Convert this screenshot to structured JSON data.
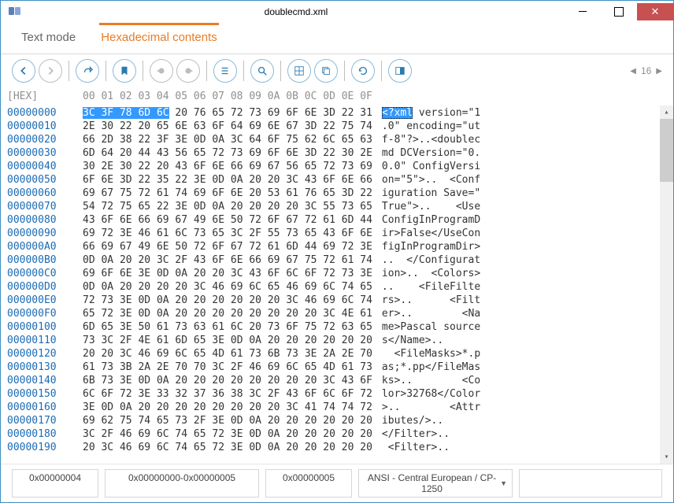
{
  "window": {
    "title": "doublecmd.xml"
  },
  "tabs": {
    "text": "Text mode",
    "hex": "Hexadecimal contents"
  },
  "page": {
    "num": "16"
  },
  "header": {
    "label": "[HEX]",
    "cols": "00 01 02 03 04 05 06 07 08 09 0A 0B 0C 0D 0E 0F"
  },
  "rows": [
    {
      "o": "00000000",
      "b": [
        "3C",
        "3F",
        "78",
        "6D",
        "6C",
        "20",
        "76",
        "65",
        "72",
        "73",
        "69",
        "6F",
        "6E",
        "3D",
        "22",
        "31"
      ],
      "a": "<?xml version=\"1",
      "sel": 5
    },
    {
      "o": "00000010",
      "b": [
        "2E",
        "30",
        "22",
        "20",
        "65",
        "6E",
        "63",
        "6F",
        "64",
        "69",
        "6E",
        "67",
        "3D",
        "22",
        "75",
        "74"
      ],
      "a": ".0\" encoding=\"ut"
    },
    {
      "o": "00000020",
      "b": [
        "66",
        "2D",
        "38",
        "22",
        "3F",
        "3E",
        "0D",
        "0A",
        "3C",
        "64",
        "6F",
        "75",
        "62",
        "6C",
        "65",
        "63"
      ],
      "a": "f-8\"?>..<doublec"
    },
    {
      "o": "00000030",
      "b": [
        "6D",
        "64",
        "20",
        "44",
        "43",
        "56",
        "65",
        "72",
        "73",
        "69",
        "6F",
        "6E",
        "3D",
        "22",
        "30",
        "2E"
      ],
      "a": "md DCVersion=\"0."
    },
    {
      "o": "00000040",
      "b": [
        "30",
        "2E",
        "30",
        "22",
        "20",
        "43",
        "6F",
        "6E",
        "66",
        "69",
        "67",
        "56",
        "65",
        "72",
        "73",
        "69"
      ],
      "a": "0.0\" ConfigVersi"
    },
    {
      "o": "00000050",
      "b": [
        "6F",
        "6E",
        "3D",
        "22",
        "35",
        "22",
        "3E",
        "0D",
        "0A",
        "20",
        "20",
        "3C",
        "43",
        "6F",
        "6E",
        "66"
      ],
      "a": "on=\"5\">..  <Conf"
    },
    {
      "o": "00000060",
      "b": [
        "69",
        "67",
        "75",
        "72",
        "61",
        "74",
        "69",
        "6F",
        "6E",
        "20",
        "53",
        "61",
        "76",
        "65",
        "3D",
        "22"
      ],
      "a": "iguration Save=\""
    },
    {
      "o": "00000070",
      "b": [
        "54",
        "72",
        "75",
        "65",
        "22",
        "3E",
        "0D",
        "0A",
        "20",
        "20",
        "20",
        "20",
        "3C",
        "55",
        "73",
        "65"
      ],
      "a": "True\">..    <Use"
    },
    {
      "o": "00000080",
      "b": [
        "43",
        "6F",
        "6E",
        "66",
        "69",
        "67",
        "49",
        "6E",
        "50",
        "72",
        "6F",
        "67",
        "72",
        "61",
        "6D",
        "44"
      ],
      "a": "ConfigInProgramD"
    },
    {
      "o": "00000090",
      "b": [
        "69",
        "72",
        "3E",
        "46",
        "61",
        "6C",
        "73",
        "65",
        "3C",
        "2F",
        "55",
        "73",
        "65",
        "43",
        "6F",
        "6E"
      ],
      "a": "ir>False</UseCon"
    },
    {
      "o": "000000A0",
      "b": [
        "66",
        "69",
        "67",
        "49",
        "6E",
        "50",
        "72",
        "6F",
        "67",
        "72",
        "61",
        "6D",
        "44",
        "69",
        "72",
        "3E"
      ],
      "a": "figInProgramDir>"
    },
    {
      "o": "000000B0",
      "b": [
        "0D",
        "0A",
        "20",
        "20",
        "3C",
        "2F",
        "43",
        "6F",
        "6E",
        "66",
        "69",
        "67",
        "75",
        "72",
        "61",
        "74"
      ],
      "a": "..  </Configurat"
    },
    {
      "o": "000000C0",
      "b": [
        "69",
        "6F",
        "6E",
        "3E",
        "0D",
        "0A",
        "20",
        "20",
        "3C",
        "43",
        "6F",
        "6C",
        "6F",
        "72",
        "73",
        "3E"
      ],
      "a": "ion>..  <Colors>"
    },
    {
      "o": "000000D0",
      "b": [
        "0D",
        "0A",
        "20",
        "20",
        "20",
        "20",
        "3C",
        "46",
        "69",
        "6C",
        "65",
        "46",
        "69",
        "6C",
        "74",
        "65"
      ],
      "a": "..    <FileFilte"
    },
    {
      "o": "000000E0",
      "b": [
        "72",
        "73",
        "3E",
        "0D",
        "0A",
        "20",
        "20",
        "20",
        "20",
        "20",
        "20",
        "3C",
        "46",
        "69",
        "6C",
        "74"
      ],
      "a": "rs>..      <Filt"
    },
    {
      "o": "000000F0",
      "b": [
        "65",
        "72",
        "3E",
        "0D",
        "0A",
        "20",
        "20",
        "20",
        "20",
        "20",
        "20",
        "20",
        "20",
        "3C",
        "4E",
        "61"
      ],
      "a": "er>..        <Na"
    },
    {
      "o": "00000100",
      "b": [
        "6D",
        "65",
        "3E",
        "50",
        "61",
        "73",
        "63",
        "61",
        "6C",
        "20",
        "73",
        "6F",
        "75",
        "72",
        "63",
        "65"
      ],
      "a": "me>Pascal source"
    },
    {
      "o": "00000110",
      "b": [
        "73",
        "3C",
        "2F",
        "4E",
        "61",
        "6D",
        "65",
        "3E",
        "0D",
        "0A",
        "20",
        "20",
        "20",
        "20",
        "20",
        "20"
      ],
      "a": "s</Name>..      "
    },
    {
      "o": "00000120",
      "b": [
        "20",
        "20",
        "3C",
        "46",
        "69",
        "6C",
        "65",
        "4D",
        "61",
        "73",
        "6B",
        "73",
        "3E",
        "2A",
        "2E",
        "70"
      ],
      "a": "  <FileMasks>*.p"
    },
    {
      "o": "00000130",
      "b": [
        "61",
        "73",
        "3B",
        "2A",
        "2E",
        "70",
        "70",
        "3C",
        "2F",
        "46",
        "69",
        "6C",
        "65",
        "4D",
        "61",
        "73"
      ],
      "a": "as;*.pp</FileMas"
    },
    {
      "o": "00000140",
      "b": [
        "6B",
        "73",
        "3E",
        "0D",
        "0A",
        "20",
        "20",
        "20",
        "20",
        "20",
        "20",
        "20",
        "20",
        "3C",
        "43",
        "6F"
      ],
      "a": "ks>..        <Co"
    },
    {
      "o": "00000150",
      "b": [
        "6C",
        "6F",
        "72",
        "3E",
        "33",
        "32",
        "37",
        "36",
        "38",
        "3C",
        "2F",
        "43",
        "6F",
        "6C",
        "6F",
        "72"
      ],
      "a": "lor>32768</Color"
    },
    {
      "o": "00000160",
      "b": [
        "3E",
        "0D",
        "0A",
        "20",
        "20",
        "20",
        "20",
        "20",
        "20",
        "20",
        "20",
        "3C",
        "41",
        "74",
        "74",
        "72"
      ],
      "a": ">..        <Attr"
    },
    {
      "o": "00000170",
      "b": [
        "69",
        "62",
        "75",
        "74",
        "65",
        "73",
        "2F",
        "3E",
        "0D",
        "0A",
        "20",
        "20",
        "20",
        "20",
        "20",
        "20"
      ],
      "a": "ibutes/>..      "
    },
    {
      "o": "00000180",
      "b": [
        "3C",
        "2F",
        "46",
        "69",
        "6C",
        "74",
        "65",
        "72",
        "3E",
        "0D",
        "0A",
        "20",
        "20",
        "20",
        "20",
        "20"
      ],
      "a": "</Filter>..     "
    },
    {
      "o": "00000190",
      "b": [
        "20",
        "3C",
        "46",
        "69",
        "6C",
        "74",
        "65",
        "72",
        "3E",
        "0D",
        "0A",
        "20",
        "20",
        "20",
        "20",
        "20"
      ],
      "a": " <Filter>..     "
    }
  ],
  "status": {
    "pos": "0x00000004",
    "range": "0x00000000-0x00000005",
    "len": "0x00000005",
    "encoding": "ANSI - Central European / CP-1250"
  }
}
